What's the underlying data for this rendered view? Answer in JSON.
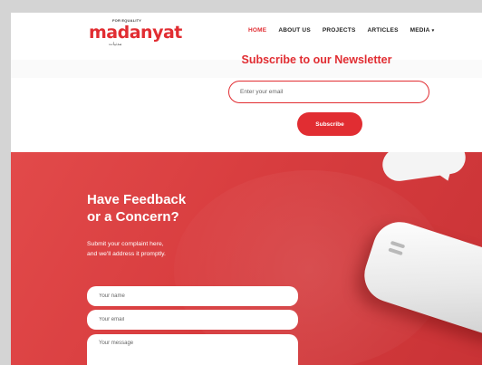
{
  "header": {
    "logo": {
      "tagline": "FOR EQUALITY",
      "wordmark": "madanyat",
      "arabic": "مدنيات"
    },
    "nav": [
      {
        "label": "HOME",
        "active": true
      },
      {
        "label": "ABOUT US",
        "active": false
      },
      {
        "label": "PROJECTS",
        "active": false
      },
      {
        "label": "ARTICLES",
        "active": false
      },
      {
        "label": "MEDIA",
        "active": false
      }
    ],
    "media_caret": "▾"
  },
  "newsletter": {
    "title": "Subscribe to our Newsletter",
    "email_placeholder": "Enter your email",
    "button_label": "Subscribe"
  },
  "feedback": {
    "title_line1": "Have Feedback",
    "title_line2": "or a Concern?",
    "desc_line1": "Submit your complaint here,",
    "desc_line2": "and we'll address it promptly.",
    "name_placeholder": "Your name",
    "email_placeholder": "Your email",
    "message_placeholder": "Your message"
  },
  "colors": {
    "brand_red": "#e12d32",
    "hero_red": "#d83d3f"
  }
}
